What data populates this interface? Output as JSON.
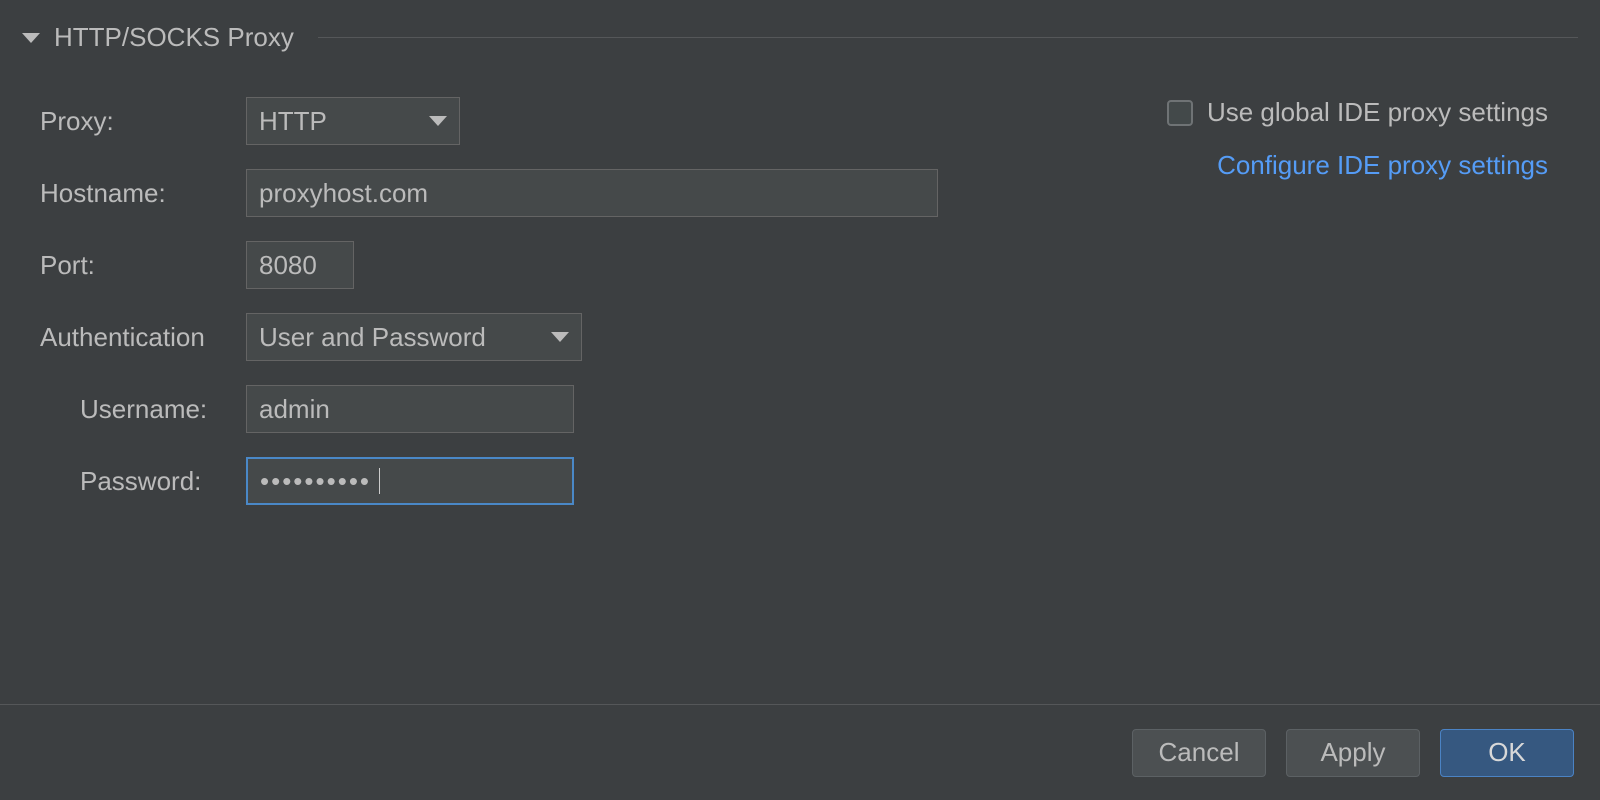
{
  "section": {
    "title": "HTTP/SOCKS Proxy"
  },
  "labels": {
    "proxy": "Proxy:",
    "hostname": "Hostname:",
    "port": "Port:",
    "authentication": "Authentication",
    "username": "Username:",
    "password": "Password:"
  },
  "fields": {
    "proxy_selected": "HTTP",
    "hostname": "proxyhost.com",
    "port": "8080",
    "auth_selected": "User and Password",
    "username": "admin",
    "password_mask": "••••••••••"
  },
  "right": {
    "use_global_label": "Use global IDE proxy settings",
    "use_global_checked": false,
    "configure_link": "Configure IDE proxy settings"
  },
  "footer": {
    "cancel": "Cancel",
    "apply": "Apply",
    "ok": "OK"
  }
}
